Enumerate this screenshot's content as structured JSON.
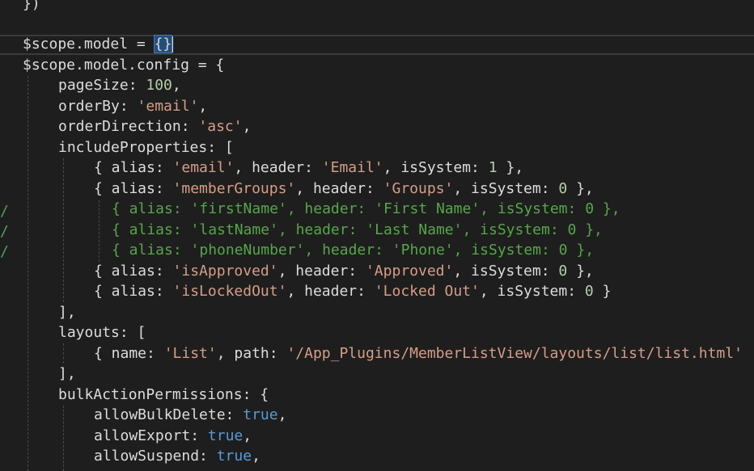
{
  "editor": {
    "language": "javascript",
    "colors": {
      "background": "#1e1e1e",
      "text": "#dcdcdc",
      "string": "#d69d85",
      "number": "#b5cea8",
      "boolean": "#569cd6",
      "comment": "#57a64a"
    },
    "lines": [
      {
        "text": "})"
      },
      {
        "text": ""
      },
      {
        "text": "$scope.model = {}",
        "cursor": true
      },
      {
        "text": "$scope.model.config = {"
      },
      {
        "text": "pageSize: 100,"
      },
      {
        "text": "orderBy: 'email',"
      },
      {
        "text": "orderDirection: 'asc',"
      },
      {
        "text": "includeProperties: ["
      },
      {
        "text": "{ alias: 'email', header: 'Email', isSystem: 1 },"
      },
      {
        "text": "{ alias: 'memberGroups', header: 'Groups', isSystem: 0 },"
      },
      {
        "text": "{ alias: 'firstName', header: 'First Name', isSystem: 0 },"
      },
      {
        "text": "{ alias: 'lastName', header: 'Last Name', isSystem: 0 },"
      },
      {
        "text": "{ alias: 'phoneNumber', header: 'Phone', isSystem: 0 },"
      },
      {
        "text": "{ alias: 'isApproved', header: 'Approved', isSystem: 0 },"
      },
      {
        "text": "{ alias: 'isLockedOut', header: 'Locked Out', isSystem: 0 }"
      },
      {
        "text": "],"
      },
      {
        "text": "layouts: ["
      },
      {
        "text": "{ name: 'List', path: '/App_Plugins/MemberListView/layouts/list/list.html'"
      },
      {
        "text": "],"
      },
      {
        "text": "bulkActionPermissions: {"
      },
      {
        "text": "allowBulkDelete: true,"
      },
      {
        "text": "allowExport: true,"
      },
      {
        "text": "allowSuspend: true,"
      }
    ]
  }
}
